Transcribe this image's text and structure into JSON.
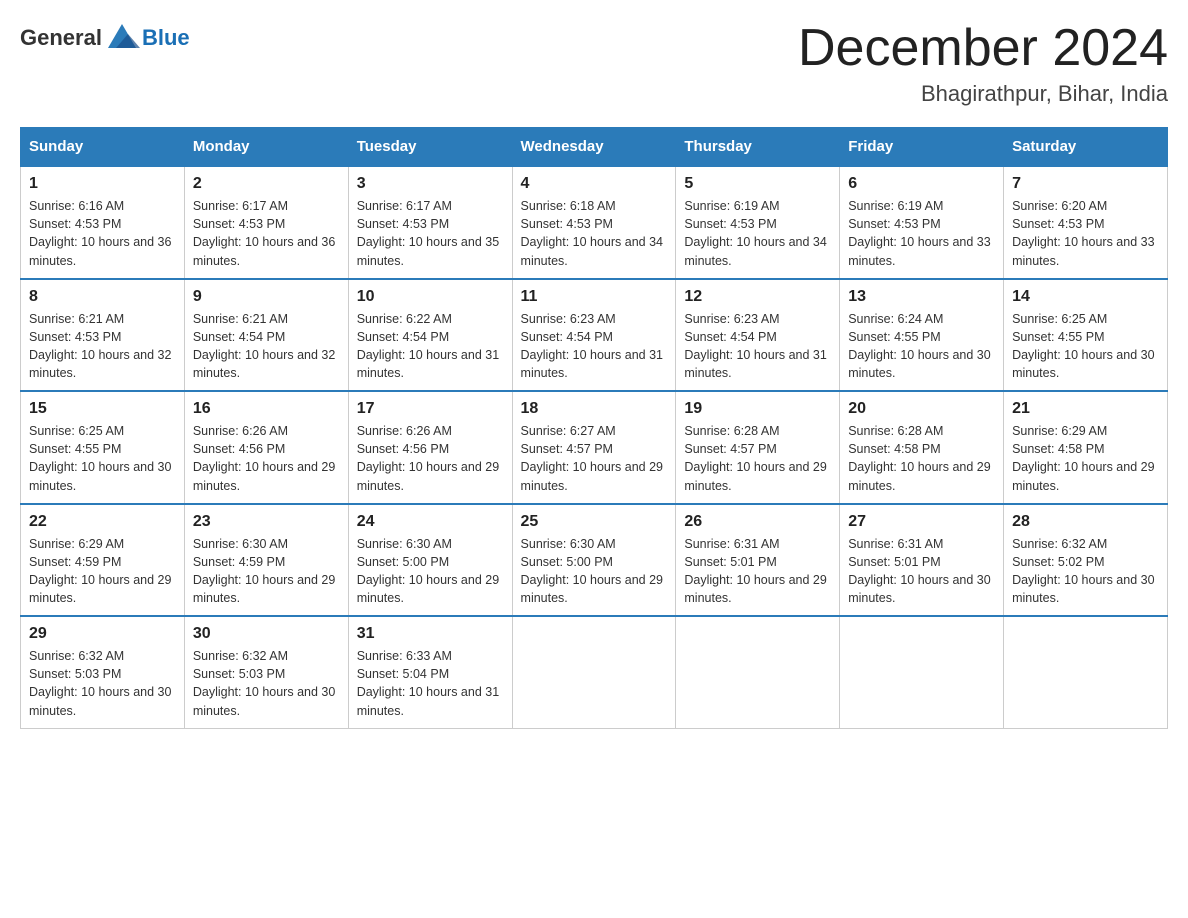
{
  "header": {
    "logo_general": "General",
    "logo_blue": "Blue",
    "month_title": "December 2024",
    "location": "Bhagirathpur, Bihar, India"
  },
  "days_of_week": [
    "Sunday",
    "Monday",
    "Tuesday",
    "Wednesday",
    "Thursday",
    "Friday",
    "Saturday"
  ],
  "weeks": [
    [
      {
        "day": "1",
        "sunrise": "6:16 AM",
        "sunset": "4:53 PM",
        "daylight": "10 hours and 36 minutes."
      },
      {
        "day": "2",
        "sunrise": "6:17 AM",
        "sunset": "4:53 PM",
        "daylight": "10 hours and 36 minutes."
      },
      {
        "day": "3",
        "sunrise": "6:17 AM",
        "sunset": "4:53 PM",
        "daylight": "10 hours and 35 minutes."
      },
      {
        "day": "4",
        "sunrise": "6:18 AM",
        "sunset": "4:53 PM",
        "daylight": "10 hours and 34 minutes."
      },
      {
        "day": "5",
        "sunrise": "6:19 AM",
        "sunset": "4:53 PM",
        "daylight": "10 hours and 34 minutes."
      },
      {
        "day": "6",
        "sunrise": "6:19 AM",
        "sunset": "4:53 PM",
        "daylight": "10 hours and 33 minutes."
      },
      {
        "day": "7",
        "sunrise": "6:20 AM",
        "sunset": "4:53 PM",
        "daylight": "10 hours and 33 minutes."
      }
    ],
    [
      {
        "day": "8",
        "sunrise": "6:21 AM",
        "sunset": "4:53 PM",
        "daylight": "10 hours and 32 minutes."
      },
      {
        "day": "9",
        "sunrise": "6:21 AM",
        "sunset": "4:54 PM",
        "daylight": "10 hours and 32 minutes."
      },
      {
        "day": "10",
        "sunrise": "6:22 AM",
        "sunset": "4:54 PM",
        "daylight": "10 hours and 31 minutes."
      },
      {
        "day": "11",
        "sunrise": "6:23 AM",
        "sunset": "4:54 PM",
        "daylight": "10 hours and 31 minutes."
      },
      {
        "day": "12",
        "sunrise": "6:23 AM",
        "sunset": "4:54 PM",
        "daylight": "10 hours and 31 minutes."
      },
      {
        "day": "13",
        "sunrise": "6:24 AM",
        "sunset": "4:55 PM",
        "daylight": "10 hours and 30 minutes."
      },
      {
        "day": "14",
        "sunrise": "6:25 AM",
        "sunset": "4:55 PM",
        "daylight": "10 hours and 30 minutes."
      }
    ],
    [
      {
        "day": "15",
        "sunrise": "6:25 AM",
        "sunset": "4:55 PM",
        "daylight": "10 hours and 30 minutes."
      },
      {
        "day": "16",
        "sunrise": "6:26 AM",
        "sunset": "4:56 PM",
        "daylight": "10 hours and 29 minutes."
      },
      {
        "day": "17",
        "sunrise": "6:26 AM",
        "sunset": "4:56 PM",
        "daylight": "10 hours and 29 minutes."
      },
      {
        "day": "18",
        "sunrise": "6:27 AM",
        "sunset": "4:57 PM",
        "daylight": "10 hours and 29 minutes."
      },
      {
        "day": "19",
        "sunrise": "6:28 AM",
        "sunset": "4:57 PM",
        "daylight": "10 hours and 29 minutes."
      },
      {
        "day": "20",
        "sunrise": "6:28 AM",
        "sunset": "4:58 PM",
        "daylight": "10 hours and 29 minutes."
      },
      {
        "day": "21",
        "sunrise": "6:29 AM",
        "sunset": "4:58 PM",
        "daylight": "10 hours and 29 minutes."
      }
    ],
    [
      {
        "day": "22",
        "sunrise": "6:29 AM",
        "sunset": "4:59 PM",
        "daylight": "10 hours and 29 minutes."
      },
      {
        "day": "23",
        "sunrise": "6:30 AM",
        "sunset": "4:59 PM",
        "daylight": "10 hours and 29 minutes."
      },
      {
        "day": "24",
        "sunrise": "6:30 AM",
        "sunset": "5:00 PM",
        "daylight": "10 hours and 29 minutes."
      },
      {
        "day": "25",
        "sunrise": "6:30 AM",
        "sunset": "5:00 PM",
        "daylight": "10 hours and 29 minutes."
      },
      {
        "day": "26",
        "sunrise": "6:31 AM",
        "sunset": "5:01 PM",
        "daylight": "10 hours and 29 minutes."
      },
      {
        "day": "27",
        "sunrise": "6:31 AM",
        "sunset": "5:01 PM",
        "daylight": "10 hours and 30 minutes."
      },
      {
        "day": "28",
        "sunrise": "6:32 AM",
        "sunset": "5:02 PM",
        "daylight": "10 hours and 30 minutes."
      }
    ],
    [
      {
        "day": "29",
        "sunrise": "6:32 AM",
        "sunset": "5:03 PM",
        "daylight": "10 hours and 30 minutes."
      },
      {
        "day": "30",
        "sunrise": "6:32 AM",
        "sunset": "5:03 PM",
        "daylight": "10 hours and 30 minutes."
      },
      {
        "day": "31",
        "sunrise": "6:33 AM",
        "sunset": "5:04 PM",
        "daylight": "10 hours and 31 minutes."
      },
      null,
      null,
      null,
      null
    ]
  ]
}
